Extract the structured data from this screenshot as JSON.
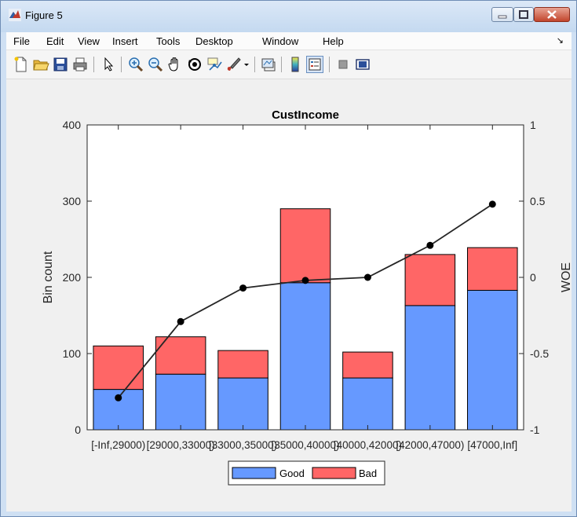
{
  "window": {
    "title": "Figure 5"
  },
  "menu": [
    "File",
    "Edit",
    "View",
    "Insert",
    "Tools",
    "Desktop",
    "Window",
    "Help"
  ],
  "toolbar_icons": [
    "new-figure-icon",
    "open-file-icon",
    "save-icon",
    "print-icon",
    "pointer-icon",
    "zoom-in-icon",
    "zoom-out-icon",
    "pan-icon",
    "rotate-3d-icon",
    "data-cursor-icon",
    "brush-icon",
    "brush-dropdown-icon",
    "link-plot-icon",
    "colorbar-icon",
    "legend-icon",
    "hide-plot-tools-icon",
    "show-plot-tools-icon"
  ],
  "chart_data": {
    "type": "bar",
    "title": "CustIncome",
    "ylabel": "Bin count",
    "ylabel_right": "WOE",
    "categories": [
      "[-Inf,29000)",
      "[29000,33000)",
      "[33000,35000)",
      "[35000,40000)",
      "[40000,42000)",
      "[42000,47000)",
      "[47000,Inf]"
    ],
    "stacked": true,
    "series": [
      {
        "name": "Good",
        "values": [
          53,
          73,
          68,
          193,
          68,
          163,
          183
        ],
        "color": "#6699ff"
      },
      {
        "name": "Bad",
        "values": [
          57,
          49,
          36,
          97,
          34,
          67,
          56
        ],
        "color": "#ff6666"
      }
    ],
    "line": {
      "axis": "right",
      "values": [
        -0.79,
        -0.29,
        -0.07,
        -0.02,
        0.0,
        0.21,
        0.48
      ],
      "color": "#000000"
    },
    "ylim": [
      0,
      400
    ],
    "yticks": [
      0,
      100,
      200,
      300,
      400
    ],
    "ylim_right": [
      -1,
      1
    ],
    "yticks_right": [
      "-1",
      "-0.5",
      "0",
      "0.5",
      "1"
    ],
    "legend": {
      "entries": [
        "Good",
        "Bad"
      ],
      "position": "bottom"
    }
  }
}
